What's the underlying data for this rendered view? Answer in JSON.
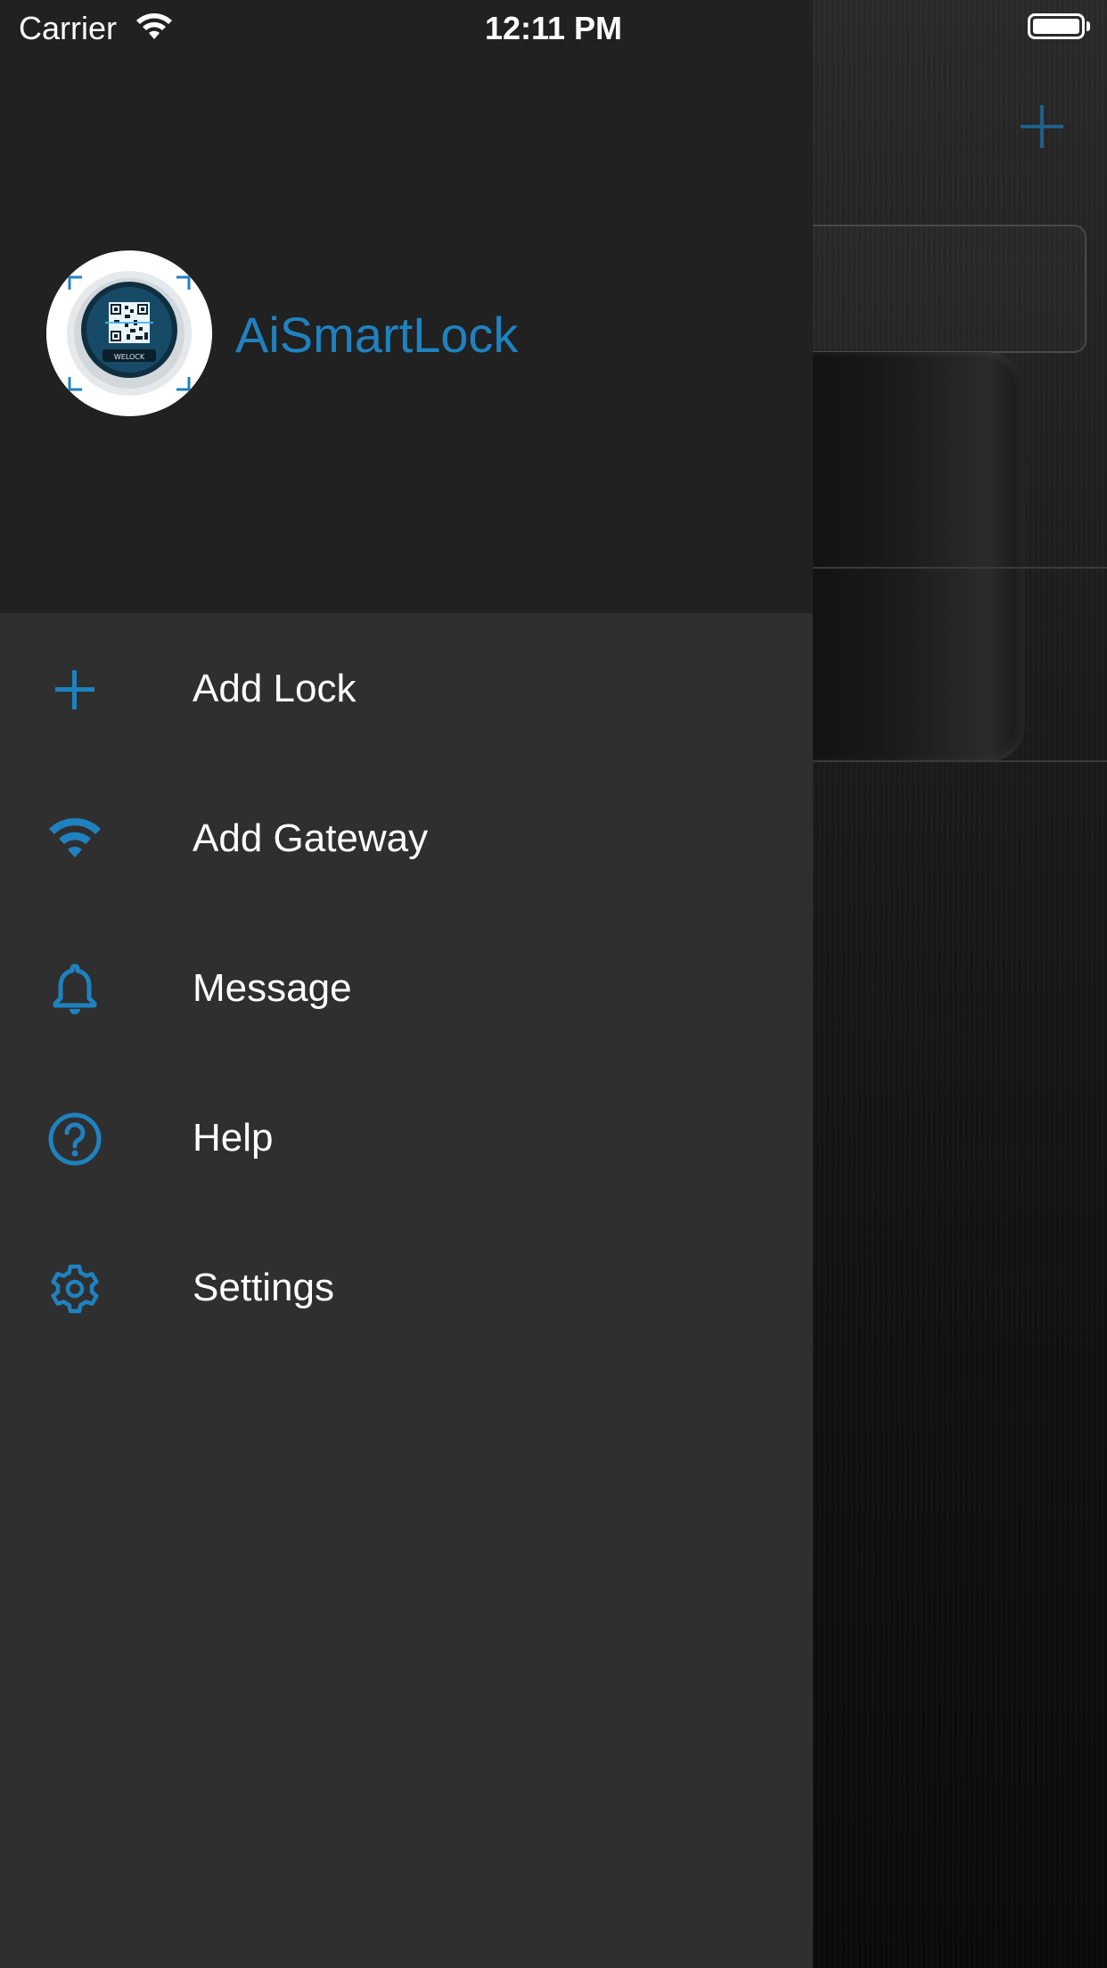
{
  "status_bar": {
    "carrier": "Carrier",
    "time": "12:11 PM"
  },
  "drawer": {
    "app_name": "AiSmartLock",
    "avatar_badge_text": "WELOCK",
    "menu_items": [
      {
        "label": "Add Lock",
        "icon": "plus-icon"
      },
      {
        "label": "Add Gateway",
        "icon": "wifi-icon"
      },
      {
        "label": "Message",
        "icon": "bell-icon"
      },
      {
        "label": "Help",
        "icon": "help-circle-icon"
      },
      {
        "label": "Settings",
        "icon": "gear-icon"
      }
    ]
  },
  "colors": {
    "accent": "#1f82c0",
    "drawer_header_bg": "#212121",
    "drawer_body_bg": "#2f2f2f",
    "menu_text": "#ffffff"
  }
}
